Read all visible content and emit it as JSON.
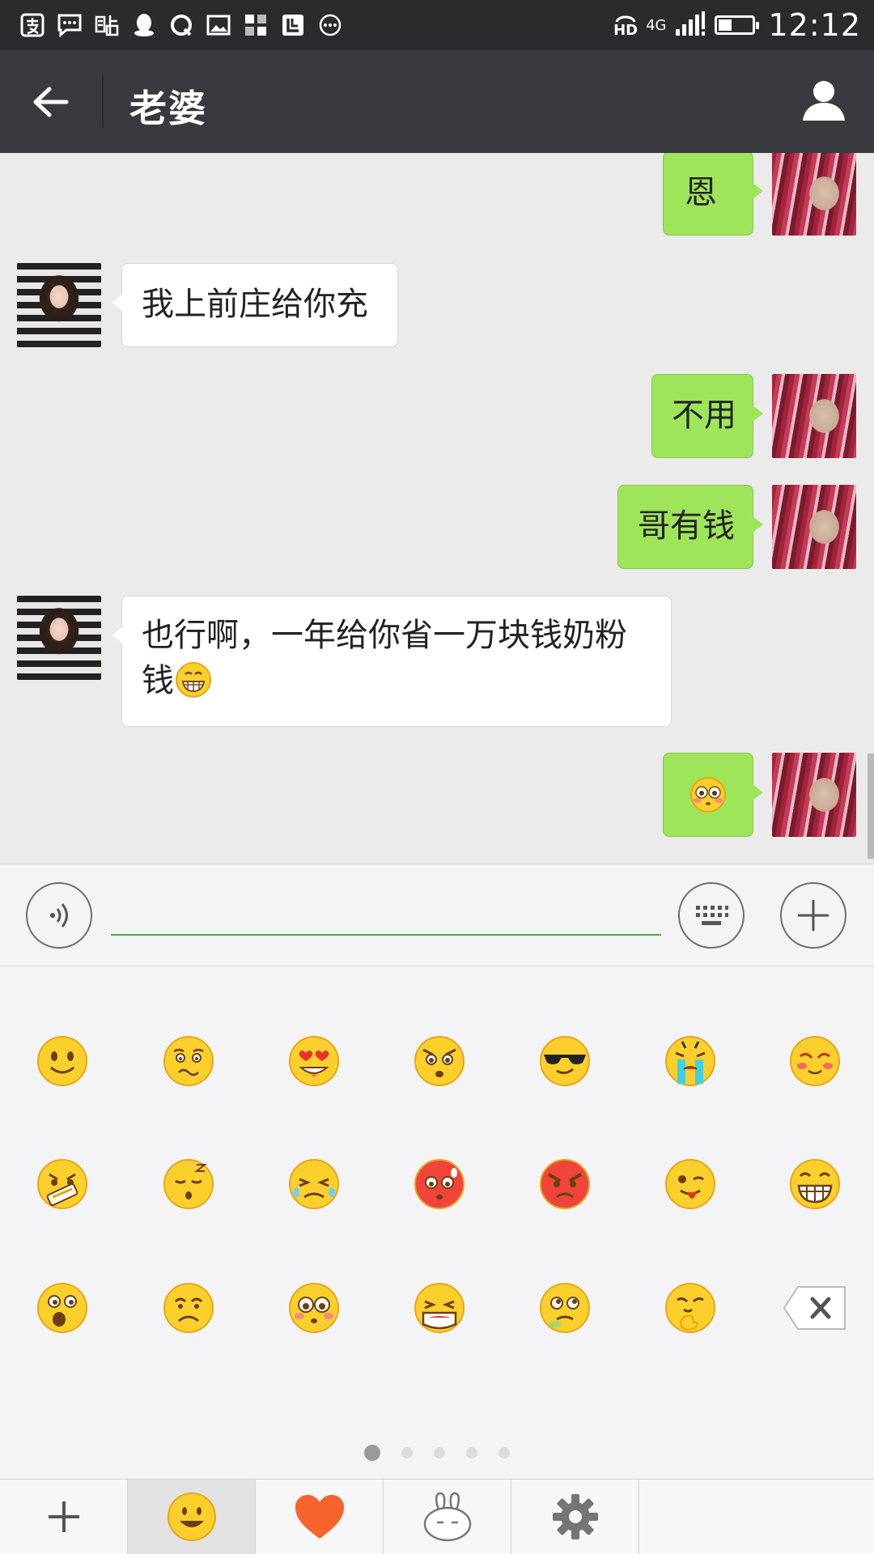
{
  "status_bar": {
    "network_hd": "HD",
    "network_type": "4G",
    "time": "12:12",
    "battery_level": 0.4,
    "left_icons": [
      "alipay-icon",
      "message-icon",
      "tieba-icon",
      "qq-icon",
      "qzone-icon",
      "gallery-icon",
      "apps-icon",
      "leshi-icon",
      "more-icon"
    ]
  },
  "header": {
    "title": "老婆"
  },
  "chat": {
    "messages": [
      {
        "side": "out",
        "text": "恩"
      },
      {
        "side": "in",
        "text": "我上前庄给你充"
      },
      {
        "side": "out",
        "text": "不用"
      },
      {
        "side": "out",
        "text": "哥有钱"
      },
      {
        "side": "in",
        "text": "也行啊，一年给你省一万块钱奶粉钱",
        "trailing_emoji": "grin-emoji"
      },
      {
        "side": "out",
        "text": "",
        "emoji": "flushed-emoji"
      }
    ]
  },
  "input": {
    "value": "",
    "placeholder": ""
  },
  "emoji_panel": {
    "rows": [
      [
        "smile-emoji",
        "worried-emoji",
        "heart-eyes-emoji",
        "stare-emoji",
        "cool-emoji",
        "crying-emoji",
        "shy-emoji"
      ],
      [
        "shush-emoji",
        "sleepy-emoji",
        "tearful-emoji",
        "embarrassed-emoji",
        "angry-emoji",
        "tongue-emoji",
        "grin-emoji"
      ],
      [
        "surprised-emoji",
        "sad-emoji",
        "flushed-emoji",
        "scream-emoji",
        "sweat-emoji",
        "giggle-emoji"
      ]
    ],
    "page_count": 5,
    "current_page": 1
  },
  "tabs": [
    "plus-icon",
    "smiley-icon",
    "heart-icon",
    "rabbit-icon",
    "settings-icon"
  ],
  "colors": {
    "outgoing_bubble": "#9fe55a",
    "incoming_bubble": "#ffffff",
    "title_bar": "#393a3f",
    "status_bar": "#2b2b2d",
    "input_underline": "#45b035"
  }
}
